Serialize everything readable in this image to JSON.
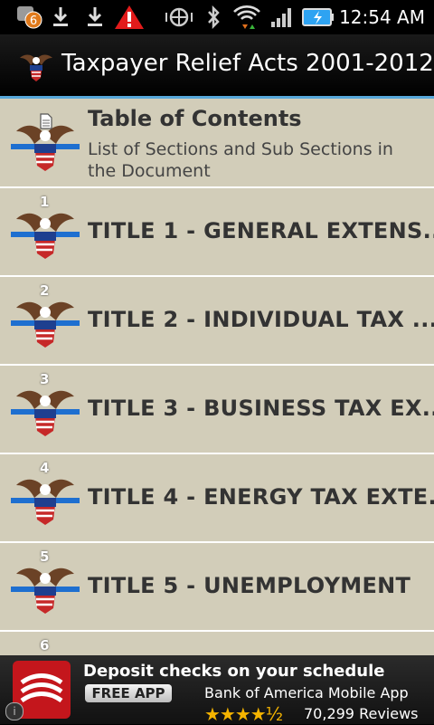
{
  "status_bar": {
    "notification_count": "6",
    "time": "12:54 AM"
  },
  "app_bar": {
    "title": "Taxpayer Relief Acts 2001-2012"
  },
  "list": {
    "toc": {
      "title": "Table of Contents",
      "subtitle": "List of Sections and Sub Sections in the Document"
    },
    "items": [
      {
        "number": "1",
        "title": "TITLE 1 - GENERAL EXTENS..."
      },
      {
        "number": "2",
        "title": "TITLE 2 - INDIVIDUAL TAX ..."
      },
      {
        "number": "3",
        "title": "TITLE 3 - BUSINESS TAX EX..."
      },
      {
        "number": "4",
        "title": "TITLE 4 - ENERGY TAX EXTE..."
      },
      {
        "number": "5",
        "title": "TITLE 5 - UNEMPLOYMENT"
      },
      {
        "number": "6",
        "title": ""
      }
    ]
  },
  "ad": {
    "headline": "Deposit checks on your schedule",
    "button_label": "FREE APP",
    "advertiser": "Bank of America Mobile App",
    "rating_stars": "★★★★½",
    "rating": 4.5,
    "reviews": "70,299 Reviews",
    "info_glyph": "i"
  },
  "colors": {
    "list_background": "#d2cdb9",
    "divider": "#ffffff",
    "accent": "#56a7d9",
    "ad_brand": "#c4161c"
  }
}
